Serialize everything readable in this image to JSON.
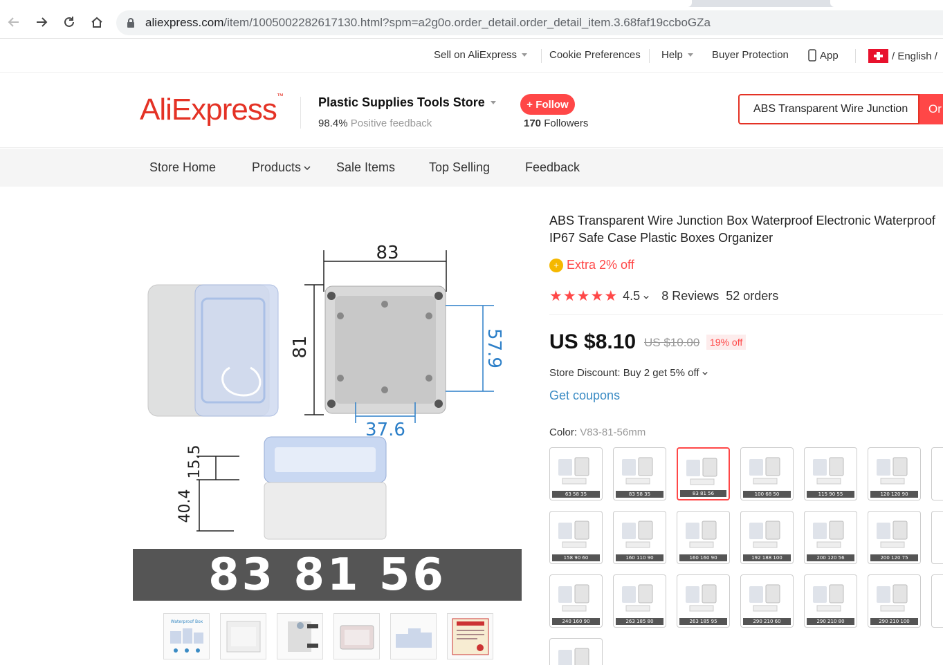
{
  "browser": {
    "url_domain": "aliexpress.com",
    "url_path": "/item/1005002282617130.html?spm=a2g0o.order_detail.order_detail_item.3.68faf19ccboGZa"
  },
  "utility": {
    "sell": "Sell on AliExpress",
    "cookie": "Cookie Preferences",
    "help": "Help",
    "buyer_protection": "Buyer Protection",
    "app": "App",
    "language": "/ English /"
  },
  "store": {
    "logo": "AliExpress",
    "name": "Plastic Supplies Tools Store",
    "feedback_pct": "98.4%",
    "feedback_label": "Positive feedback",
    "follow_label": "+ Follow",
    "followers_count": "170",
    "followers_label": "Followers",
    "search_value": "ABS Transparent Wire Junction",
    "search_btn": "Or"
  },
  "store_nav": [
    "Store Home",
    "Products",
    "Sale Items",
    "Top Selling",
    "Feedback"
  ],
  "gallery": {
    "dims": {
      "top": "83",
      "left": "81",
      "right": "57.9",
      "bottom": "37.6",
      "lid": "15.5",
      "body": "40.4"
    },
    "band_text": "83 81 56",
    "thumb_count": 6
  },
  "product": {
    "title": "ABS Transparent Wire Junction Box Waterproof Electronic Waterproof IP67 Safe Case Plastic Boxes Organizer",
    "extra_off": "Extra 2% off",
    "rating": "4.5",
    "reviews": "8 Reviews",
    "orders": "52 orders",
    "price": "US $8.10",
    "old_price": "US $10.00",
    "discount": "19% off",
    "store_discount": "Store Discount: Buy 2 get 5% off",
    "coupons": "Get coupons",
    "color_label": "Color:",
    "color_value": "V83-81-56mm"
  },
  "swatches": [
    "63 58 35",
    "83 58 35",
    "83 81 56",
    "100 68 50",
    "115 90 55",
    "120 120 90",
    "158 90 60",
    "160 110 90",
    "160 160 90",
    "192 188 100",
    "200 120 56",
    "200 120 75",
    "240 160 90",
    "263 185 80",
    "263 185 95",
    "290 210 60",
    "290 210 80",
    "290 210 100"
  ],
  "selected_swatch": 2,
  "colors": {
    "accent": "#ff4747",
    "brand": "#e43225",
    "link": "#3a8bc4"
  }
}
